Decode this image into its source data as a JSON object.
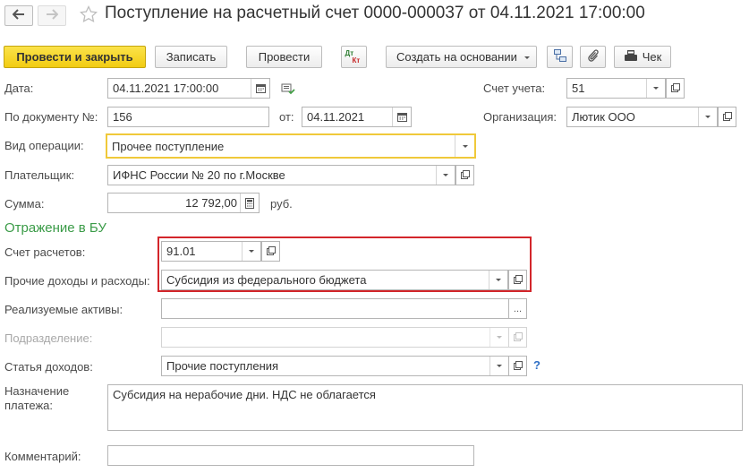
{
  "header": {
    "title": "Поступление на расчетный счет 0000-000037 от 04.11.2021 17:00:00",
    "back_icon": "arrow-left-icon",
    "forward_icon": "arrow-right-icon",
    "favorite_icon": "star-icon"
  },
  "toolbar": {
    "post_close": "Провести и закрыть",
    "save": "Записать",
    "post": "Провести",
    "dtkt_top": "Дт",
    "dtkt_bottom": "Кт",
    "create_based": "Создать на основании",
    "receipt": "Чек"
  },
  "form": {
    "date_label": "Дата:",
    "date_value": "04.11.2021 17:00:00",
    "account_label": "Счет учета:",
    "account_value": "51",
    "doc_label": "По документу №:",
    "doc_value": "156",
    "from_label": "от:",
    "from_value": "04.11.2021",
    "org_label": "Организация:",
    "org_value": "Лютик ООО",
    "operation_label": "Вид операции:",
    "operation_value": "Прочее поступление",
    "payer_label": "Плательщик:",
    "payer_value": "ИФНС России № 20 по г.Москве",
    "sum_label": "Сумма:",
    "sum_value": "12 792,00",
    "sum_unit": "руб."
  },
  "accounting": {
    "section_title": "Отражение в БУ",
    "settlement_label": "Счет расчетов:",
    "settlement_value": "91.01",
    "other_label": "Прочие доходы и расходы:",
    "other_value": "Субсидия из федерального бюджета",
    "assets_label": "Реализуемые активы:",
    "assets_value": "",
    "dept_label": "Подразделение:",
    "dept_value": "",
    "income_label": "Статья доходов:",
    "income_value": "Прочие поступления",
    "help": "?"
  },
  "bottom": {
    "purpose_label": "Назначение платежа:",
    "purpose_value": "Субсидия на нерабочие дни. НДС не облагается",
    "comment_label": "Комментарий:",
    "comment_value": ""
  },
  "colors": {
    "primary_button": "#f2cc12",
    "section_title": "#3a9b47",
    "highlight_border": "#d3262b",
    "focus_border": "#f0c93a"
  }
}
